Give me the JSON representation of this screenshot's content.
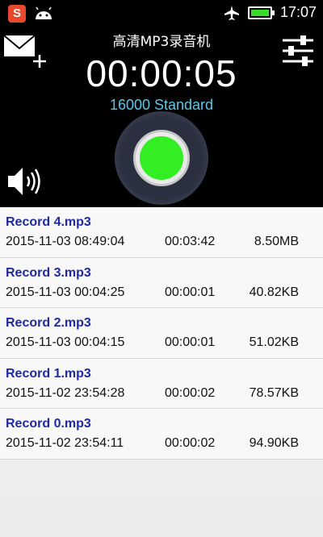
{
  "status_bar": {
    "app_icon_label": "S",
    "time": "17:07",
    "icons": [
      "app-icon",
      "android-icon",
      "airplane-icon",
      "battery-icon"
    ],
    "battery_color": "#3cdc2c"
  },
  "header": {
    "title": "高清MP3录音机",
    "timer": "00:00:05",
    "quality": "16000 Standard",
    "icons": [
      "mail-add-icon",
      "settings-sliders-icon",
      "speaker-icon"
    ],
    "record_button_color": "#33ee22",
    "quality_color": "#5bc8ea"
  },
  "recordings": [
    {
      "name": "Record 4.mp3",
      "date": "2015-11-03 08:49:04",
      "duration": "00:03:42",
      "size": "8.50MB"
    },
    {
      "name": "Record 3.mp3",
      "date": "2015-11-03 00:04:25",
      "duration": "00:00:01",
      "size": "40.82KB"
    },
    {
      "name": "Record 2.mp3",
      "date": "2015-11-03 00:04:15",
      "duration": "00:00:01",
      "size": "51.02KB"
    },
    {
      "name": "Record 1.mp3",
      "date": "2015-11-02 23:54:28",
      "duration": "00:00:02",
      "size": "78.57KB"
    },
    {
      "name": "Record 0.mp3",
      "date": "2015-11-02 23:54:11",
      "duration": "00:00:02",
      "size": "94.90KB"
    }
  ]
}
